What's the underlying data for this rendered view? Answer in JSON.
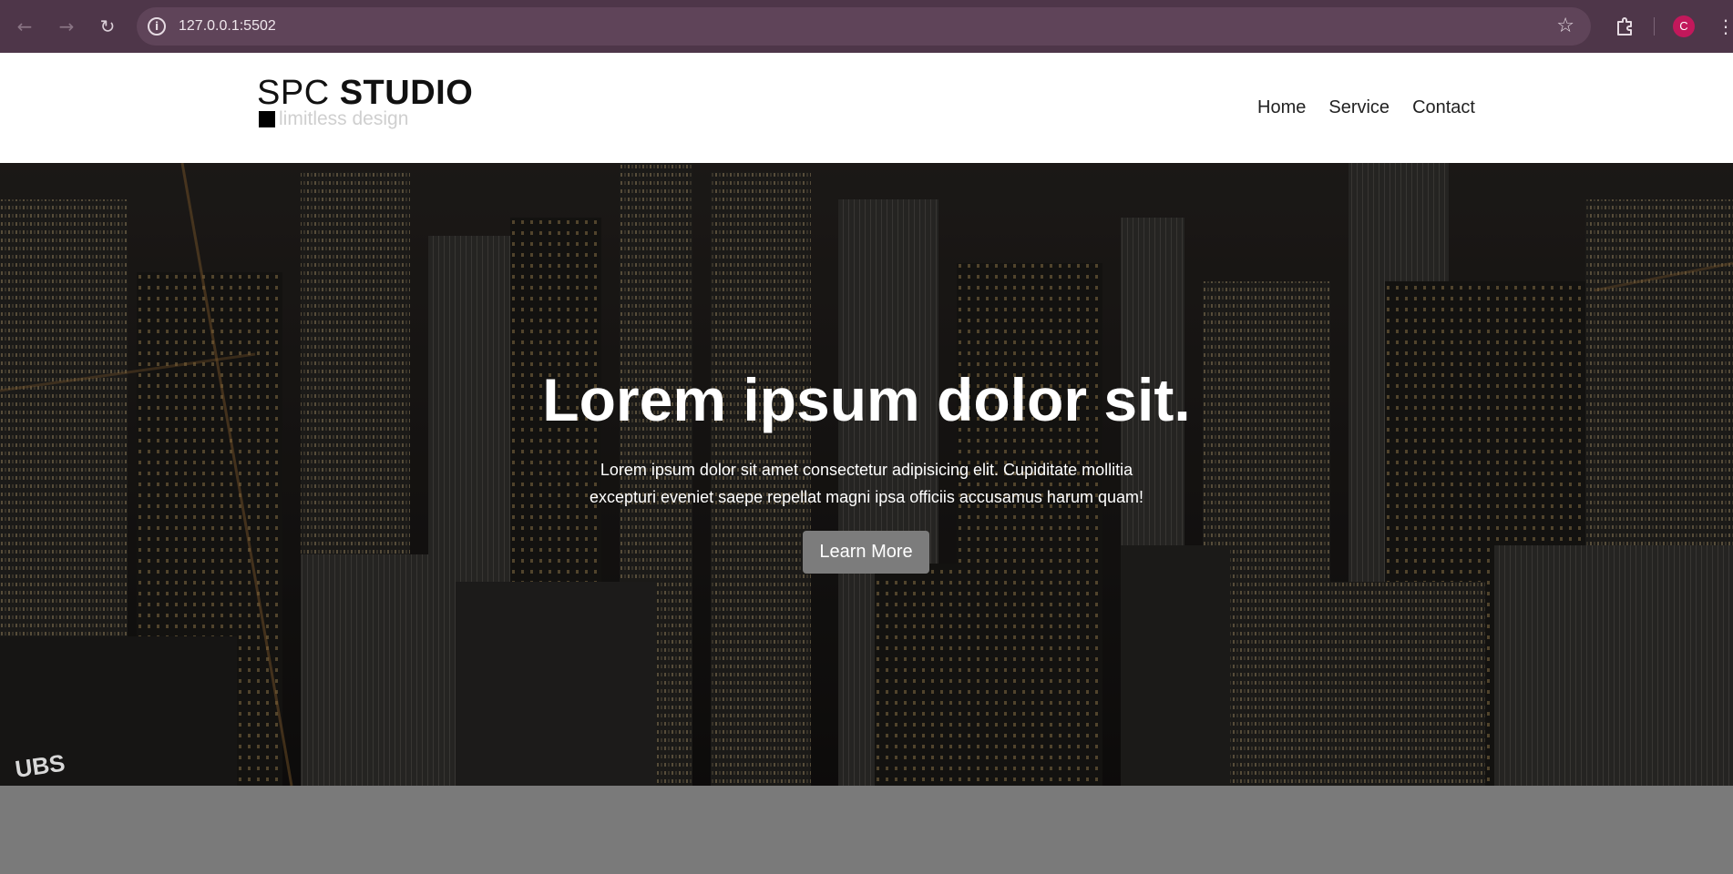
{
  "browser": {
    "back_icon": "←",
    "forward_icon": "→",
    "reload_icon": "↻",
    "url": "127.0.0.1:5502",
    "info_icon": "i",
    "bookmark_icon": "☆",
    "profile_initial": "C",
    "profile_color": "#c2185b",
    "menu_icon": "⋮"
  },
  "site": {
    "logo": {
      "brand_light": "SPC",
      "brand_bold": "STUDIO",
      "tagline": "limitless design"
    },
    "nav": [
      "Home",
      "Service",
      "Contact"
    ]
  },
  "hero": {
    "title": "Lorem ipsum dolor sit.",
    "text": "Lorem ipsum dolor sit amet consectetur adipisicing elit. Cupiditate mollitia excepturi eveniet saepe repellat magni ipsa officiis accusamus harum quam!",
    "button": "Learn More",
    "watermark": "UBS"
  },
  "colors": {
    "chrome_bg": "#4e3649",
    "header_bg": "#ffffff",
    "button_bg": "#7c7c7c",
    "below_bg": "#7a7a7a"
  }
}
